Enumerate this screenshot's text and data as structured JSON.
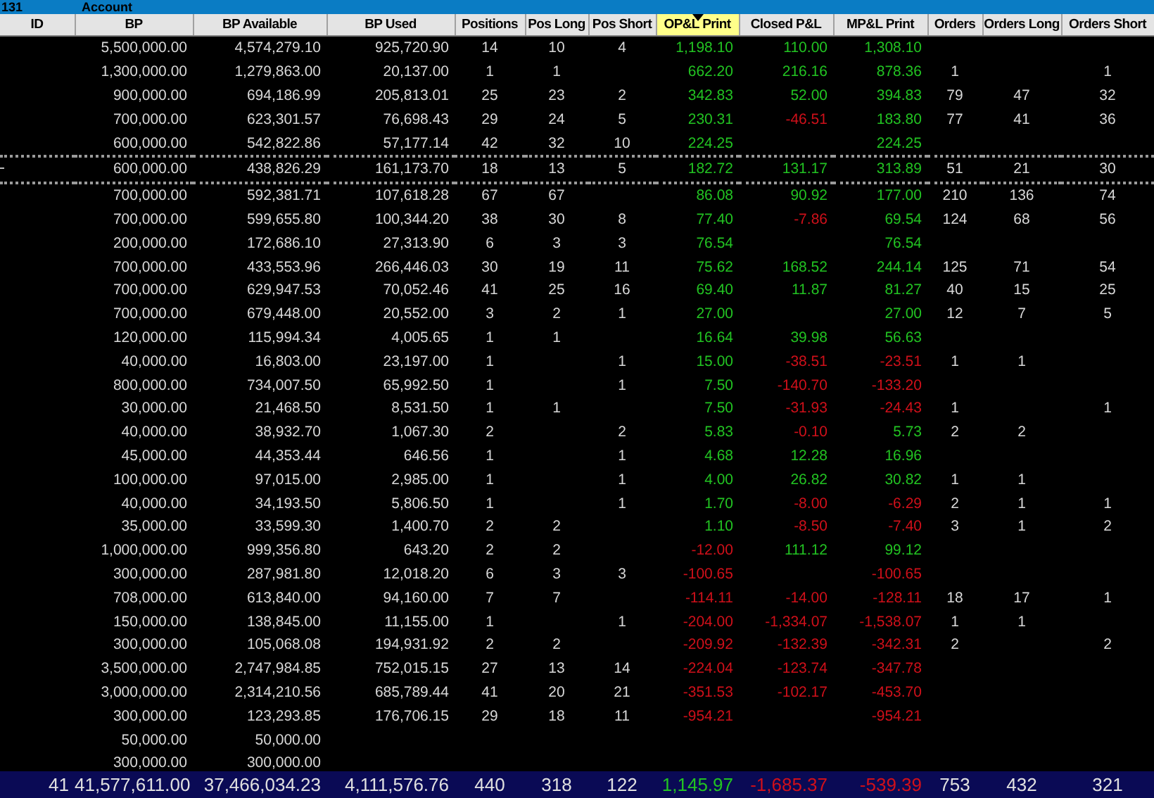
{
  "title_bar": {
    "number": "131",
    "label": "Account"
  },
  "columns": [
    {
      "label": "ID",
      "kind": "id",
      "sorted": false
    },
    {
      "label": "BP",
      "kind": "money",
      "sorted": false
    },
    {
      "label": "BP Available",
      "kind": "money",
      "sorted": false
    },
    {
      "label": "BP Used",
      "kind": "money",
      "sorted": false
    },
    {
      "label": "Positions",
      "kind": "count",
      "sorted": false
    },
    {
      "label": "Pos Long",
      "kind": "count",
      "sorted": false
    },
    {
      "label": "Pos Short",
      "kind": "count",
      "sorted": false
    },
    {
      "label": "OP&L Print",
      "kind": "pnl",
      "sorted": true
    },
    {
      "label": "Closed P&L",
      "kind": "pnl",
      "sorted": false
    },
    {
      "label": "MP&L Print",
      "kind": "pnl",
      "sorted": false
    },
    {
      "label": "Orders",
      "kind": "count",
      "sorted": false
    },
    {
      "label": "Orders Long",
      "kind": "count",
      "sorted": false
    },
    {
      "label": "Orders Short",
      "kind": "count",
      "sorted": false
    }
  ],
  "rows": [
    {
      "selected": false,
      "cells": [
        null,
        "5,500,000.00",
        "4,574,279.10",
        "925,720.90",
        "14",
        "10",
        "4",
        {
          "text": "1,198.10",
          "color": "#22c322"
        },
        {
          "text": "110.00",
          "color": "#22c322"
        },
        {
          "text": "1,308.10",
          "color": "#22c322"
        },
        null,
        null,
        null
      ]
    },
    {
      "selected": false,
      "cells": [
        null,
        "1,300,000.00",
        "1,279,863.00",
        "20,137.00",
        "1",
        "1",
        null,
        {
          "text": "662.20",
          "color": "#22c322"
        },
        {
          "text": "216.16",
          "color": "#22c322"
        },
        {
          "text": "878.36",
          "color": "#22c322"
        },
        "1",
        null,
        "1"
      ]
    },
    {
      "selected": false,
      "cells": [
        null,
        "900,000.00",
        "694,186.99",
        "205,813.01",
        "25",
        "23",
        "2",
        {
          "text": "342.83",
          "color": "#22c322"
        },
        {
          "text": "52.00",
          "color": "#22c322"
        },
        {
          "text": "394.83",
          "color": "#22c322"
        },
        "79",
        "47",
        "32"
      ]
    },
    {
      "selected": false,
      "cells": [
        null,
        "700,000.00",
        "623,301.57",
        "76,698.43",
        "29",
        "24",
        "5",
        {
          "text": "230.31",
          "color": "#22c322"
        },
        {
          "text": "-46.51",
          "color": "#d0101a"
        },
        {
          "text": "183.80",
          "color": "#22c322"
        },
        "77",
        "41",
        "36"
      ]
    },
    {
      "selected": false,
      "cells": [
        null,
        "600,000.00",
        "542,822.86",
        "57,177.14",
        "42",
        "32",
        "10",
        {
          "text": "224.25",
          "color": "#22c322"
        },
        null,
        {
          "text": "224.25",
          "color": "#22c322"
        },
        null,
        null,
        null
      ]
    },
    {
      "selected": true,
      "cells": [
        null,
        "600,000.00",
        "438,826.29",
        "161,173.70",
        "18",
        "13",
        "5",
        {
          "text": "182.72",
          "color": "#22c322"
        },
        {
          "text": "131.17",
          "color": "#22c322"
        },
        {
          "text": "313.89",
          "color": "#22c322"
        },
        "51",
        "21",
        "30"
      ]
    },
    {
      "selected": false,
      "cells": [
        null,
        "700,000.00",
        "592,381.71",
        "107,618.28",
        "67",
        "67",
        null,
        {
          "text": "86.08",
          "color": "#22c322"
        },
        {
          "text": "90.92",
          "color": "#22c322"
        },
        {
          "text": "177.00",
          "color": "#22c322"
        },
        "210",
        "136",
        "74"
      ]
    },
    {
      "selected": false,
      "cells": [
        null,
        "700,000.00",
        "599,655.80",
        "100,344.20",
        "38",
        "30",
        "8",
        {
          "text": "77.40",
          "color": "#22c322"
        },
        {
          "text": "-7.86",
          "color": "#d0101a"
        },
        {
          "text": "69.54",
          "color": "#22c322"
        },
        "124",
        "68",
        "56"
      ]
    },
    {
      "selected": false,
      "cells": [
        null,
        "200,000.00",
        "172,686.10",
        "27,313.90",
        "6",
        "3",
        "3",
        {
          "text": "76.54",
          "color": "#22c322"
        },
        null,
        {
          "text": "76.54",
          "color": "#22c322"
        },
        null,
        null,
        null
      ]
    },
    {
      "selected": false,
      "cells": [
        null,
        "700,000.00",
        "433,553.96",
        "266,446.03",
        "30",
        "19",
        "11",
        {
          "text": "75.62",
          "color": "#22c322"
        },
        {
          "text": "168.52",
          "color": "#22c322"
        },
        {
          "text": "244.14",
          "color": "#22c322"
        },
        "125",
        "71",
        "54"
      ]
    },
    {
      "selected": false,
      "cells": [
        null,
        "700,000.00",
        "629,947.53",
        "70,052.46",
        "41",
        "25",
        "16",
        {
          "text": "69.40",
          "color": "#22c322"
        },
        {
          "text": "11.87",
          "color": "#22c322"
        },
        {
          "text": "81.27",
          "color": "#22c322"
        },
        "40",
        "15",
        "25"
      ]
    },
    {
      "selected": false,
      "cells": [
        null,
        "700,000.00",
        "679,448.00",
        "20,552.00",
        "3",
        "2",
        "1",
        {
          "text": "27.00",
          "color": "#22c322"
        },
        null,
        {
          "text": "27.00",
          "color": "#22c322"
        },
        "12",
        "7",
        "5"
      ]
    },
    {
      "selected": false,
      "cells": [
        null,
        "120,000.00",
        "115,994.34",
        "4,005.65",
        "1",
        "1",
        null,
        {
          "text": "16.64",
          "color": "#22c322"
        },
        {
          "text": "39.98",
          "color": "#22c322"
        },
        {
          "text": "56.63",
          "color": "#22c322"
        },
        null,
        null,
        null
      ]
    },
    {
      "selected": false,
      "cells": [
        null,
        "40,000.00",
        "16,803.00",
        "23,197.00",
        "1",
        null,
        "1",
        {
          "text": "15.00",
          "color": "#22c322"
        },
        {
          "text": "-38.51",
          "color": "#d0101a"
        },
        {
          "text": "-23.51",
          "color": "#d0101a"
        },
        "1",
        "1",
        null
      ]
    },
    {
      "selected": false,
      "cells": [
        null,
        "800,000.00",
        "734,007.50",
        "65,992.50",
        "1",
        null,
        "1",
        {
          "text": "7.50",
          "color": "#22c322"
        },
        {
          "text": "-140.70",
          "color": "#d0101a"
        },
        {
          "text": "-133.20",
          "color": "#d0101a"
        },
        null,
        null,
        null
      ]
    },
    {
      "selected": false,
      "cells": [
        null,
        "30,000.00",
        "21,468.50",
        "8,531.50",
        "1",
        "1",
        null,
        {
          "text": "7.50",
          "color": "#22c322"
        },
        {
          "text": "-31.93",
          "color": "#d0101a"
        },
        {
          "text": "-24.43",
          "color": "#d0101a"
        },
        "1",
        null,
        "1"
      ]
    },
    {
      "selected": false,
      "cells": [
        null,
        "40,000.00",
        "38,932.70",
        "1,067.30",
        "2",
        null,
        "2",
        {
          "text": "5.83",
          "color": "#22c322"
        },
        {
          "text": "-0.10",
          "color": "#d0101a"
        },
        {
          "text": "5.73",
          "color": "#22c322"
        },
        "2",
        "2",
        null
      ]
    },
    {
      "selected": false,
      "cells": [
        null,
        "45,000.00",
        "44,353.44",
        "646.56",
        "1",
        null,
        "1",
        {
          "text": "4.68",
          "color": "#22c322"
        },
        {
          "text": "12.28",
          "color": "#22c322"
        },
        {
          "text": "16.96",
          "color": "#22c322"
        },
        null,
        null,
        null
      ]
    },
    {
      "selected": false,
      "cells": [
        null,
        "100,000.00",
        "97,015.00",
        "2,985.00",
        "1",
        null,
        "1",
        {
          "text": "4.00",
          "color": "#22c322"
        },
        {
          "text": "26.82",
          "color": "#22c322"
        },
        {
          "text": "30.82",
          "color": "#22c322"
        },
        "1",
        "1",
        null
      ]
    },
    {
      "selected": false,
      "cells": [
        null,
        "40,000.00",
        "34,193.50",
        "5,806.50",
        "1",
        null,
        "1",
        {
          "text": "1.70",
          "color": "#22c322"
        },
        {
          "text": "-8.00",
          "color": "#d0101a"
        },
        {
          "text": "-6.29",
          "color": "#d0101a"
        },
        "2",
        "1",
        "1"
      ]
    },
    {
      "selected": false,
      "cells": [
        null,
        "35,000.00",
        "33,599.30",
        "1,400.70",
        "2",
        "2",
        null,
        {
          "text": "1.10",
          "color": "#22c322"
        },
        {
          "text": "-8.50",
          "color": "#d0101a"
        },
        {
          "text": "-7.40",
          "color": "#d0101a"
        },
        "3",
        "1",
        "2"
      ]
    },
    {
      "selected": false,
      "cells": [
        null,
        "1,000,000.00",
        "999,356.80",
        "643.20",
        "2",
        "2",
        null,
        {
          "text": "-12.00",
          "color": "#d0101a"
        },
        {
          "text": "111.12",
          "color": "#22c322"
        },
        {
          "text": "99.12",
          "color": "#22c322"
        },
        null,
        null,
        null
      ]
    },
    {
      "selected": false,
      "cells": [
        null,
        "300,000.00",
        "287,981.80",
        "12,018.20",
        "6",
        "3",
        "3",
        {
          "text": "-100.65",
          "color": "#d0101a"
        },
        null,
        {
          "text": "-100.65",
          "color": "#d0101a"
        },
        null,
        null,
        null
      ]
    },
    {
      "selected": false,
      "cells": [
        null,
        "708,000.00",
        "613,840.00",
        "94,160.00",
        "7",
        "7",
        null,
        {
          "text": "-114.11",
          "color": "#d0101a"
        },
        {
          "text": "-14.00",
          "color": "#d0101a"
        },
        {
          "text": "-128.11",
          "color": "#d0101a"
        },
        "18",
        "17",
        "1"
      ]
    },
    {
      "selected": false,
      "cells": [
        null,
        "150,000.00",
        "138,845.00",
        "11,155.00",
        "1",
        null,
        "1",
        {
          "text": "-204.00",
          "color": "#d0101a"
        },
        {
          "text": "-1,334.07",
          "color": "#d0101a"
        },
        {
          "text": "-1,538.07",
          "color": "#d0101a"
        },
        "1",
        "1",
        null
      ]
    },
    {
      "selected": false,
      "cells": [
        null,
        "300,000.00",
        "105,068.08",
        "194,931.92",
        "2",
        "2",
        null,
        {
          "text": "-209.92",
          "color": "#d0101a"
        },
        {
          "text": "-132.39",
          "color": "#d0101a"
        },
        {
          "text": "-342.31",
          "color": "#d0101a"
        },
        "2",
        null,
        "2"
      ]
    },
    {
      "selected": false,
      "cells": [
        null,
        "3,500,000.00",
        "2,747,984.85",
        "752,015.15",
        "27",
        "13",
        "14",
        {
          "text": "-224.04",
          "color": "#d0101a"
        },
        {
          "text": "-123.74",
          "color": "#d0101a"
        },
        {
          "text": "-347.78",
          "color": "#d0101a"
        },
        null,
        null,
        null
      ]
    },
    {
      "selected": false,
      "cells": [
        null,
        "3,000,000.00",
        "2,314,210.56",
        "685,789.44",
        "41",
        "20",
        "21",
        {
          "text": "-351.53",
          "color": "#d0101a"
        },
        {
          "text": "-102.17",
          "color": "#d0101a"
        },
        {
          "text": "-453.70",
          "color": "#d0101a"
        },
        null,
        null,
        null
      ]
    },
    {
      "selected": false,
      "cells": [
        null,
        "300,000.00",
        "123,293.85",
        "176,706.15",
        "29",
        "18",
        "11",
        {
          "text": "-954.21",
          "color": "#d0101a"
        },
        null,
        {
          "text": "-954.21",
          "color": "#d0101a"
        },
        null,
        null,
        null
      ]
    },
    {
      "selected": false,
      "cells": [
        null,
        "50,000.00",
        "50,000.00",
        null,
        null,
        null,
        null,
        null,
        null,
        null,
        null,
        null,
        null
      ]
    },
    {
      "selected": false,
      "cells": [
        null,
        "300,000.00",
        "300,000.00",
        null,
        null,
        null,
        null,
        null,
        null,
        null,
        null,
        null,
        null
      ]
    }
  ],
  "totals": [
    "41",
    "41,577,611.00",
    "37,466,034.23",
    "4,111,576.76",
    "440",
    "318",
    "122",
    {
      "text": "1,145.97",
      "color": "#22c322"
    },
    {
      "text": "-1,685.37",
      "color": "#d0101a"
    },
    {
      "text": "-539.39",
      "color": "#d0101a"
    },
    "753",
    "432",
    "321"
  ]
}
